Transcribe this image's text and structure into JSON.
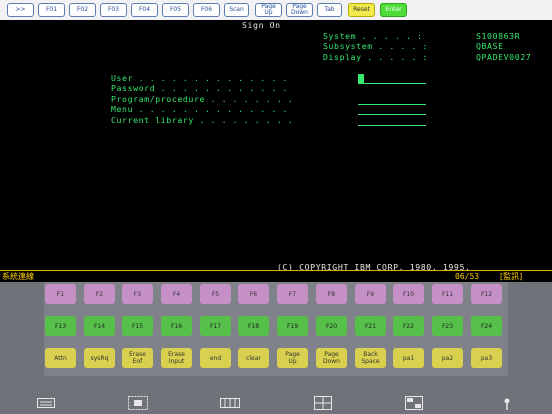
{
  "toolbar": {
    "buttons": [
      {
        "label": ">>",
        "style": "normal"
      },
      {
        "label": "F01",
        "style": "normal"
      },
      {
        "label": "F02",
        "style": "normal"
      },
      {
        "label": "F03",
        "style": "normal"
      },
      {
        "label": "F04",
        "style": "normal"
      },
      {
        "label": "F05",
        "style": "normal"
      },
      {
        "label": "F06",
        "style": "normal"
      },
      {
        "label": "Scan",
        "style": "normal"
      },
      {
        "label": "Page\nUp",
        "style": "normal"
      },
      {
        "label": "Page\nDown",
        "style": "normal"
      },
      {
        "label": "Tab",
        "style": "normal"
      },
      {
        "label": "Reset",
        "style": "yellow"
      },
      {
        "label": "Enter",
        "style": "green"
      }
    ]
  },
  "screen": {
    "title": "Sign On",
    "system_label": "System . . . . . :",
    "system_value": "S100863R",
    "subsystem_label": "Subsystem . . . . :",
    "subsystem_value": "QBASE",
    "display_label": "Display . . . . . :",
    "display_value": "QPADEV0027",
    "fields": [
      {
        "label": "User . . . . . . . . . . . . . ."
      },
      {
        "label": "Password . . . . . . . . . . . ."
      },
      {
        "label": "Program/procedure . . . . . . . ."
      },
      {
        "label": "Menu . . . . . . . . . . . . . ."
      },
      {
        "label": "Current library . . . . . . . . ."
      }
    ],
    "copyright": "(C) COPYRIGHT IBM CORP. 1980, 1995."
  },
  "status": {
    "left": "系統連線",
    "position": "06/53",
    "right": "[監訊]"
  },
  "keyboard": {
    "row1": [
      "F1",
      "F2",
      "F3",
      "F4",
      "F5",
      "F6",
      "F7",
      "F8",
      "F9",
      "F10",
      "F11",
      "F12"
    ],
    "row2": [
      "F13",
      "F14",
      "F15",
      "F16",
      "F17",
      "F18",
      "F19",
      "F20",
      "F21",
      "F22",
      "F23",
      "F24"
    ],
    "row3": [
      "Attn",
      "sysRq",
      "Erase\nEof",
      "Erase\nInput",
      "end",
      "clear",
      "Page\nUp",
      "Page\nDown",
      "Back\nSpace",
      "pa1",
      "pa2",
      "pa3"
    ]
  },
  "bottom_icons": [
    "keyboard-icon",
    "expand-icon",
    "keypad-icon",
    "ab-yz-icon",
    "grid-font-icon",
    "joystick-icon"
  ],
  "colors": {
    "screen_text": "#35e86f",
    "status_accent": "#d2b400",
    "purple_key": "#c590c6",
    "green_key": "#56c04a",
    "yellow_key": "#d8d04e"
  }
}
